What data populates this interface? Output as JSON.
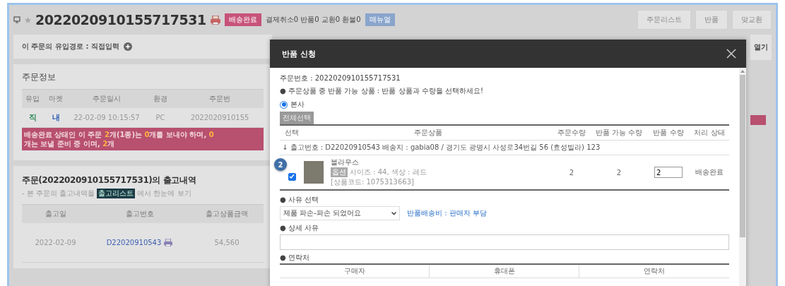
{
  "header": {
    "order_number": "2022020910155717531",
    "status_badge": "배송완료",
    "counts": "결제취소0 반품0 교환0 환불0",
    "manual_badge": "매뉴얼",
    "buttons": [
      "주문리스트",
      "반품",
      "맞교환"
    ]
  },
  "inflow": {
    "label": "이 주문의 유입경로 : 직접입력",
    "side_button": "열기"
  },
  "order_info": {
    "title": "주문정보",
    "columns": [
      "유입",
      "마켓",
      "주문일시",
      "환경",
      "주문번"
    ],
    "row": [
      {
        "text": "직",
        "color": "#2e8b57"
      },
      {
        "text": "내",
        "color": "#2f5fb3"
      },
      {
        "text": "22-02-09 10:15:57"
      },
      {
        "text": "PC"
      },
      {
        "text": "2022020910155"
      }
    ],
    "banner": [
      {
        "text": "배송완료",
        "highlight": false
      },
      {
        "text": " 상태인 이 주문 ",
        "highlight": false
      },
      {
        "text": "2",
        "highlight": true
      },
      {
        "text": "개(1종)는 ",
        "highlight": false
      },
      {
        "text": "0",
        "highlight": true
      },
      {
        "text": "개를 보내야 하며, ",
        "highlight": false
      },
      {
        "text": "0",
        "highlight": true
      },
      {
        "text": "개는 보낼 준비 중 이며, ",
        "highlight": false
      },
      {
        "text": "2",
        "highlight": true
      },
      {
        "text": "개",
        "highlight": false
      }
    ]
  },
  "shipments": {
    "title": "주문(2022020910155717531)의 출고내역",
    "note_before": "- 본 주문의 출고내역을",
    "note_tag": "출고리스트",
    "note_after": "에서 한눈에 보기",
    "columns": [
      "출고일",
      "출고번호",
      "출고상품금액"
    ],
    "rows": [
      {
        "date": "2022-02-09",
        "number": "D22020910543",
        "amount": "54,560"
      }
    ]
  },
  "modal": {
    "title": "반품 신청",
    "order_line": "주문번호 : 2022020910155717531",
    "instruction": "● 주문상품 중 반품 가능 상품 : 반품 상품과 수량을 선택하세요!",
    "sources": [
      {
        "label": "본사",
        "selected": true
      }
    ],
    "select_all": "전체선택",
    "columns": [
      "선택",
      "주문상품",
      "주문수량",
      "반품 가능 수량",
      "반품 수량",
      "처리 상태"
    ],
    "shipment_line": "↓ 출고번호 : D22020910543    배송지 : gabia08 / 경기도 광명시 사성로34번길 56 (효성빌라) 123",
    "items": [
      {
        "marker": "2",
        "checked": true,
        "name": "블라우스",
        "option_tag": "옵션",
        "option": "사이즈 : 44, 색상 : 레드",
        "code": "[상품코드: 1075313663]",
        "ordered": "2",
        "returnable": "2",
        "return_qty": "2",
        "status": "배송완료"
      }
    ],
    "reason": {
      "label": "● 사유 선택",
      "value": "제품 파손-파손 되었어요",
      "shipping_fee": "반품배송비 : 판매자 부담"
    },
    "detail": {
      "label": "● 상세 사유"
    },
    "contact": {
      "label": "● 연락처",
      "columns": [
        "구매자",
        "휴대폰",
        "연락처"
      ]
    }
  }
}
